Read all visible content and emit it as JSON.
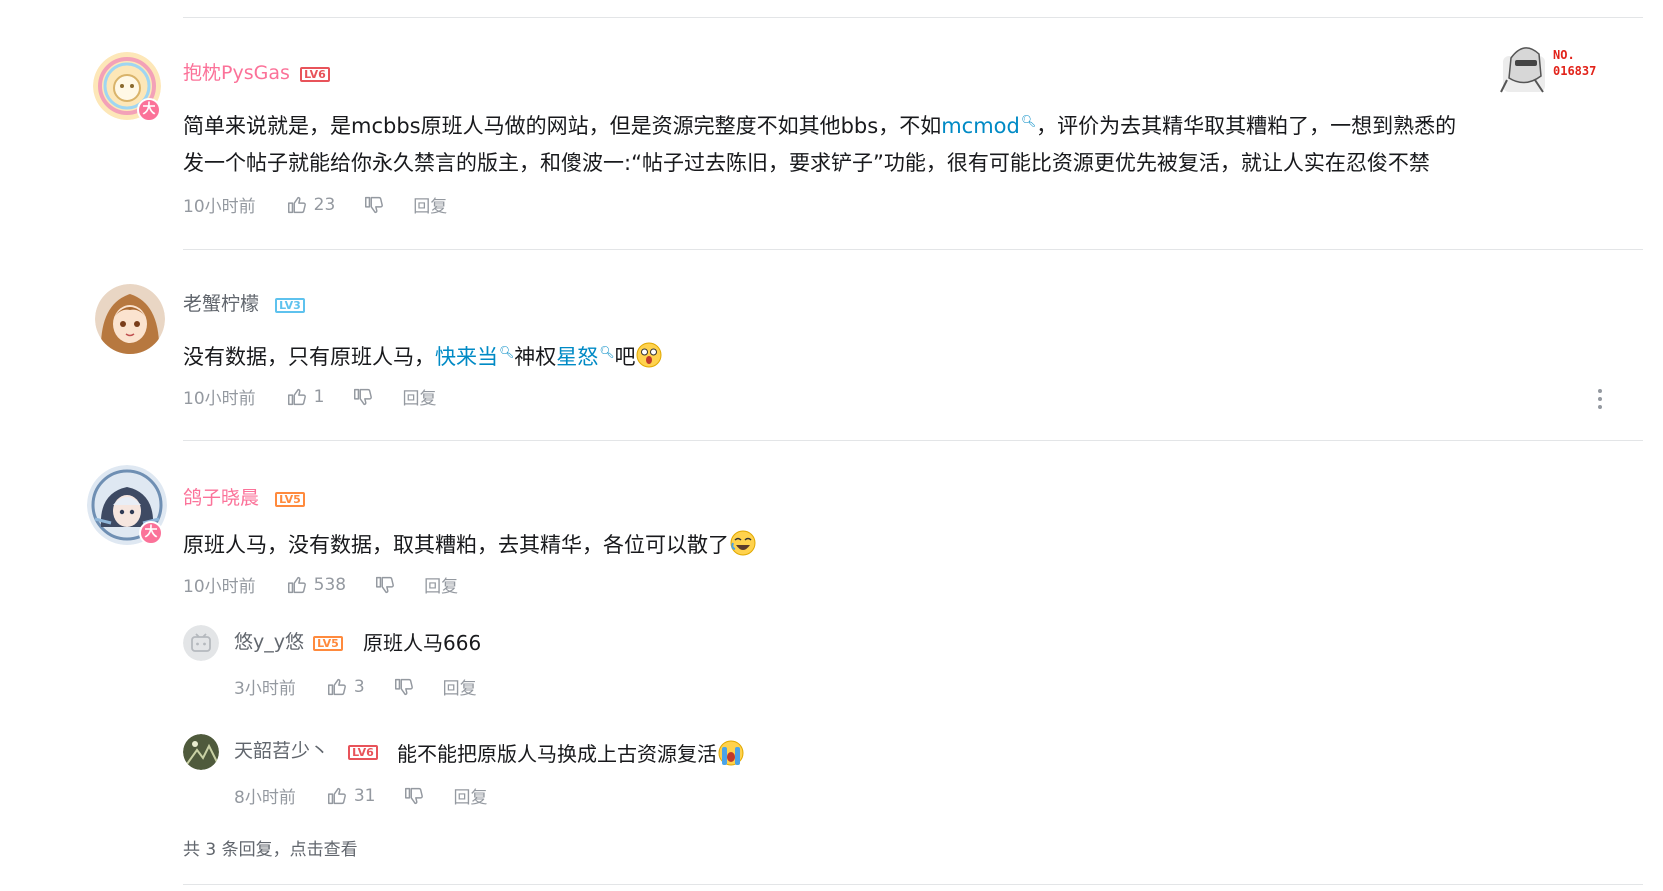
{
  "comments": [
    {
      "username": "抱枕PysGas",
      "level": "LV6",
      "content_parts": [
        "简单来说就是，是mcbbs原班人马做的网站，但是资源完整度不如其他bbs，不如",
        "mcmod",
        "，评价为去其精华取其糟粕了，一想到熟悉的",
        "发一个帖子就能给你永久禁言的版主，和傻波一:“帖子过去陈旧，要求铲子”功能，很有可能比资源更优先被复活，就让人实在忍俊不禁"
      ],
      "time": "10小时前",
      "likes": "23",
      "reply_label": "回复",
      "vip_badge": "大",
      "decor_label_no": "NO.",
      "decor_label_num": "016837"
    },
    {
      "username": "老蟹柠檬",
      "level": "LV3",
      "content_parts": [
        "没有数据，只有原班人马，",
        "快来当",
        "神权",
        "星怒",
        "吧"
      ],
      "time": "10小时前",
      "likes": "1",
      "reply_label": "回复"
    },
    {
      "username": "鸽子晓晨",
      "level": "LV5",
      "content": "原班人马，没有数据，取其糟粕，去其精华，各位可以散了",
      "time": "10小时前",
      "likes": "538",
      "reply_label": "回复",
      "vip_badge": "大",
      "replies": [
        {
          "username": "悠y_y悠",
          "level": "LV5",
          "content": "原班人马666",
          "time": "3小时前",
          "likes": "3",
          "reply_label": "回复"
        },
        {
          "username": "天韶苕少丶",
          "level": "LV6",
          "content": "能不能把原版人马换成上古资源复活",
          "time": "8小时前",
          "likes": "31",
          "reply_label": "回复"
        }
      ],
      "view_more": "共 3 条回复，点击查看"
    }
  ],
  "colors": {
    "vip_name": "#fb7299",
    "normal_name": "#61666d",
    "keyword_link": "#008ac5",
    "meta_gray": "#9499a0",
    "divider": "#e3e5e7"
  },
  "icons": [
    "thumbs-up-icon",
    "thumbs-down-icon",
    "search-keyword-icon",
    "more-vertical-icon"
  ]
}
